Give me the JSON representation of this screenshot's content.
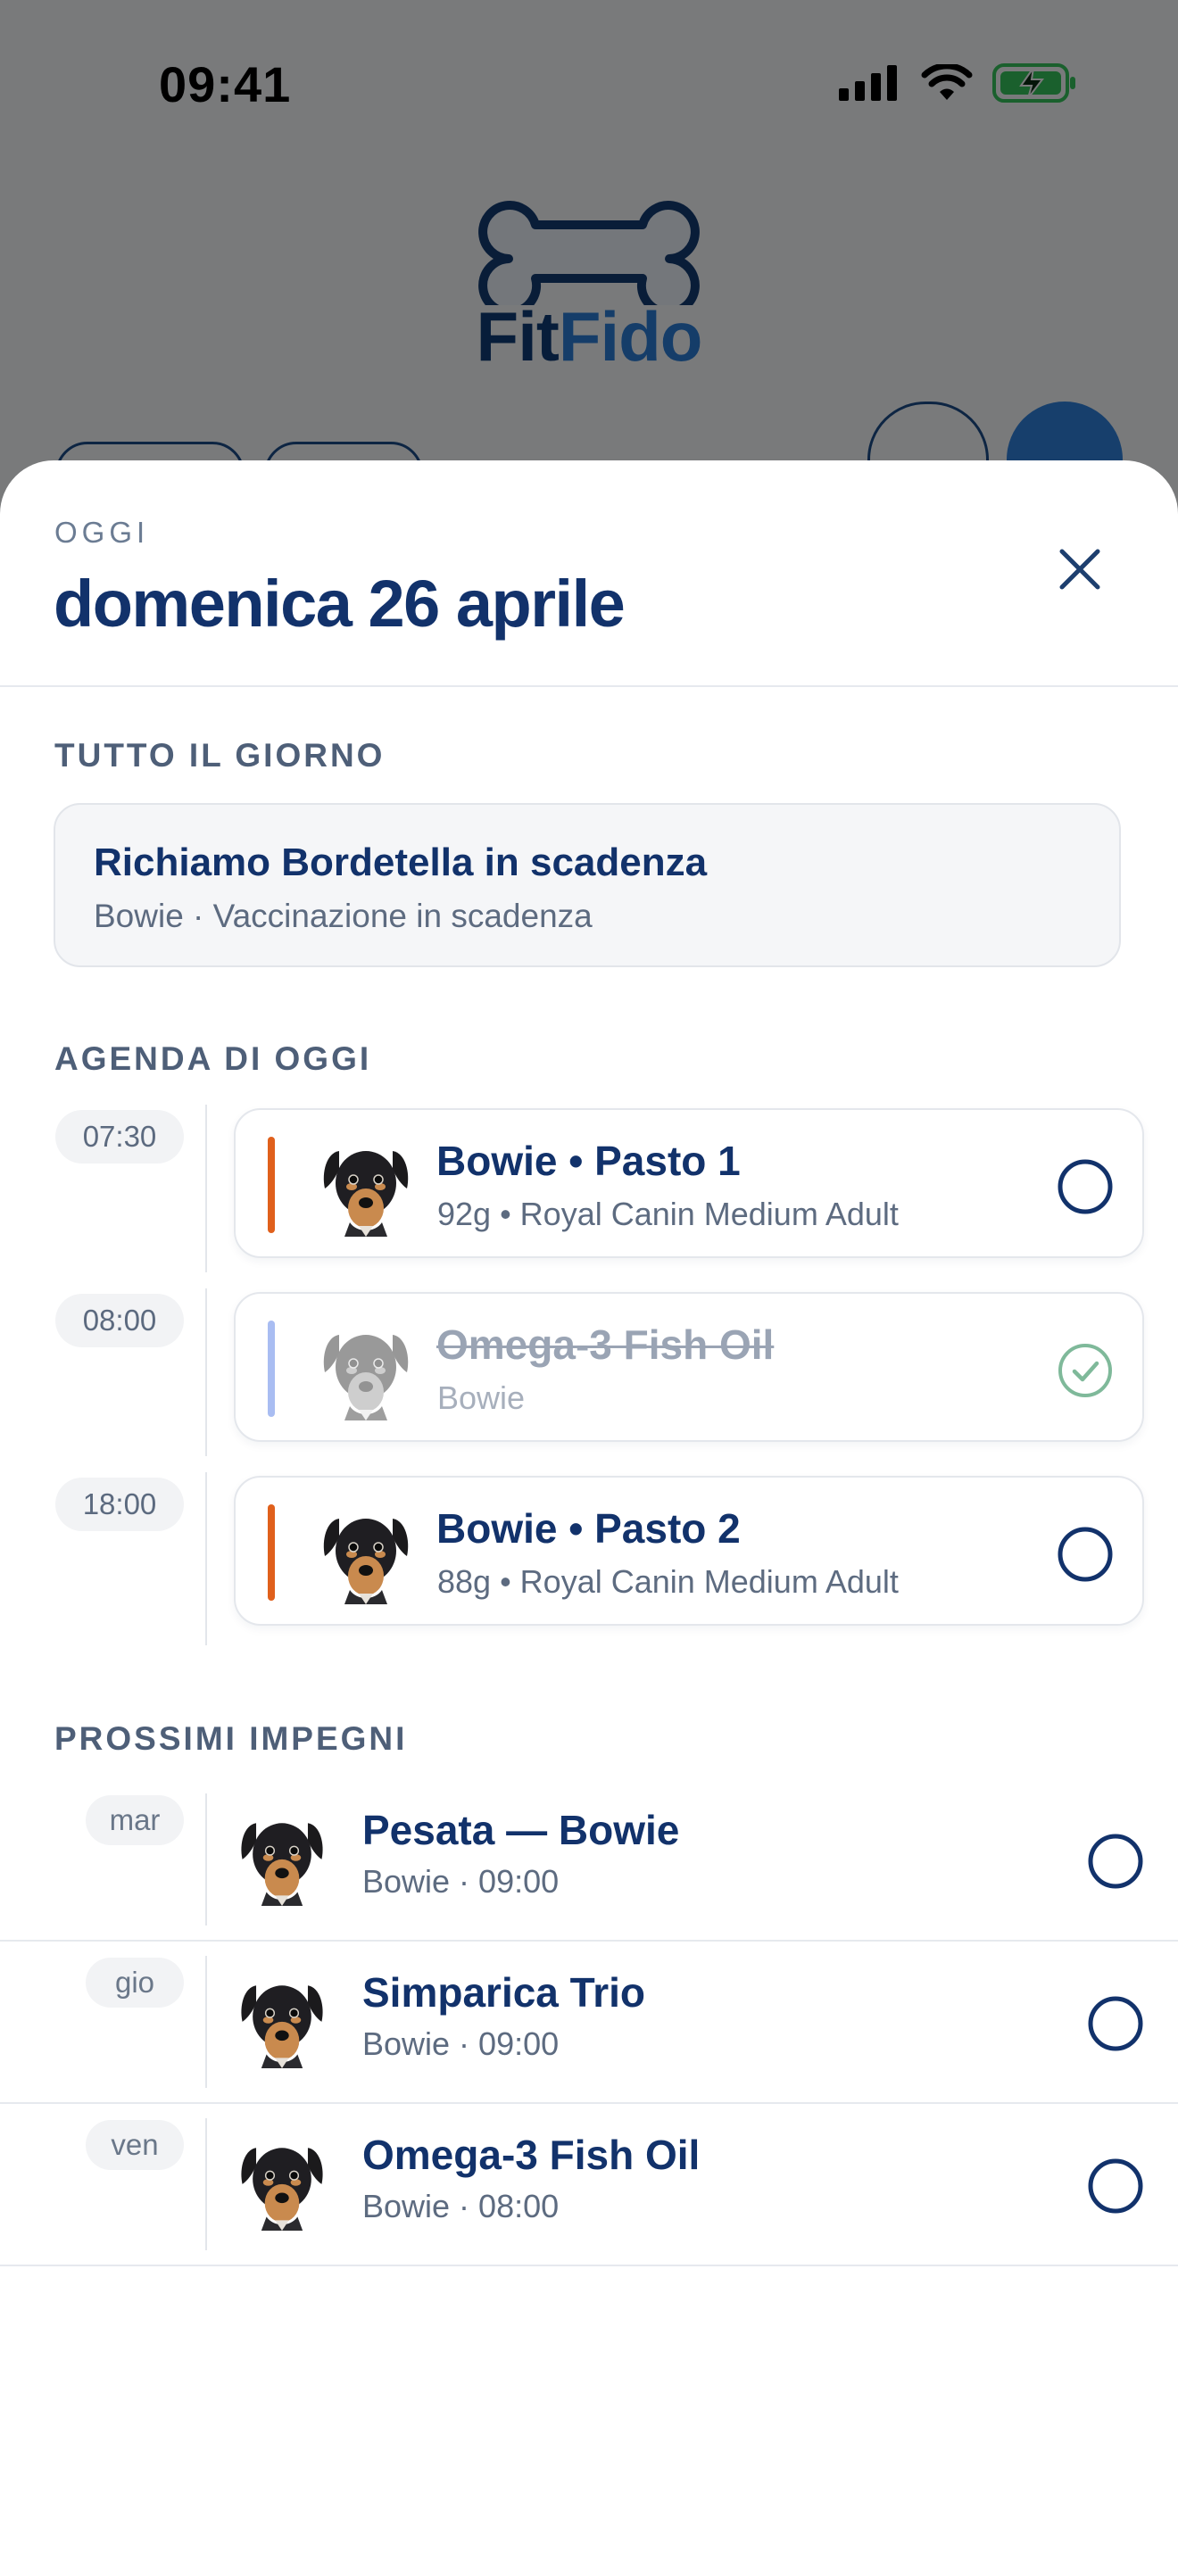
{
  "status_bar": {
    "time": "09:41"
  },
  "app": {
    "logo_fit": "Fit",
    "logo_fido": "Fido"
  },
  "sheet": {
    "eyebrow": "OGGI",
    "title": "domenica 26 aprile",
    "all_day": {
      "label": "TUTTO IL GIORNO",
      "title": "Richiamo Bordetella in scadenza",
      "subtitle": "Bowie · Vaccinazione in scadenza"
    },
    "agenda": {
      "label": "AGENDA DI OGGI",
      "items": [
        {
          "time": "07:30",
          "title": "Bowie • Pasto 1",
          "subtitle": "92g • Royal Canin Medium Adult",
          "accent": "#e0601c",
          "done": false
        },
        {
          "time": "08:00",
          "title": "Omega-3 Fish Oil",
          "subtitle": "Bowie",
          "accent": "#a9bdf2",
          "done": true
        },
        {
          "time": "18:00",
          "title": "Bowie • Pasto 2",
          "subtitle": "88g • Royal Canin Medium Adult",
          "accent": "#e0601c",
          "done": false
        }
      ]
    },
    "upcoming": {
      "label": "PROSSIMI IMPEGNI",
      "items": [
        {
          "day": "mar",
          "title": "Pesata — Bowie",
          "subtitle": "Bowie · 09:00"
        },
        {
          "day": "gio",
          "title": "Simparica Trio",
          "subtitle": "Bowie · 09:00"
        },
        {
          "day": "ven",
          "title": "Omega-3 Fish Oil",
          "subtitle": "Bowie · 08:00"
        }
      ]
    }
  },
  "colors": {
    "brand_navy": "#12326b",
    "brand_blue": "#2a7bd2",
    "accent_orange": "#e0601c",
    "done_green": "#7fb99a"
  },
  "icons": {
    "close": "close-icon",
    "check": "check-circle-icon",
    "pet": "dog-avatar-icon"
  }
}
